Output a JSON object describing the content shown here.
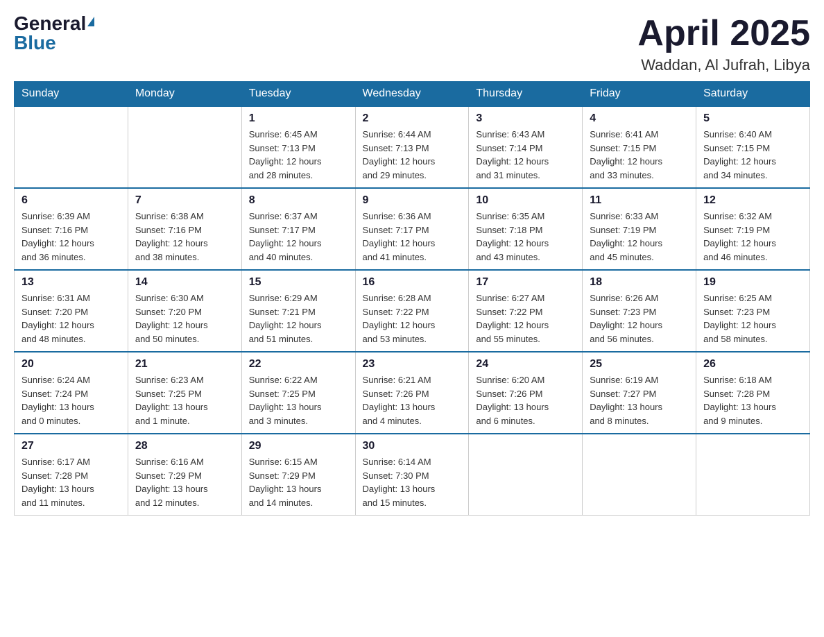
{
  "header": {
    "logo_general": "General",
    "logo_blue": "Blue",
    "title": "April 2025",
    "location": "Waddan, Al Jufrah, Libya"
  },
  "days_of_week": [
    "Sunday",
    "Monday",
    "Tuesday",
    "Wednesday",
    "Thursday",
    "Friday",
    "Saturday"
  ],
  "weeks": [
    [
      {
        "day": "",
        "info": ""
      },
      {
        "day": "",
        "info": ""
      },
      {
        "day": "1",
        "info": "Sunrise: 6:45 AM\nSunset: 7:13 PM\nDaylight: 12 hours\nand 28 minutes."
      },
      {
        "day": "2",
        "info": "Sunrise: 6:44 AM\nSunset: 7:13 PM\nDaylight: 12 hours\nand 29 minutes."
      },
      {
        "day": "3",
        "info": "Sunrise: 6:43 AM\nSunset: 7:14 PM\nDaylight: 12 hours\nand 31 minutes."
      },
      {
        "day": "4",
        "info": "Sunrise: 6:41 AM\nSunset: 7:15 PM\nDaylight: 12 hours\nand 33 minutes."
      },
      {
        "day": "5",
        "info": "Sunrise: 6:40 AM\nSunset: 7:15 PM\nDaylight: 12 hours\nand 34 minutes."
      }
    ],
    [
      {
        "day": "6",
        "info": "Sunrise: 6:39 AM\nSunset: 7:16 PM\nDaylight: 12 hours\nand 36 minutes."
      },
      {
        "day": "7",
        "info": "Sunrise: 6:38 AM\nSunset: 7:16 PM\nDaylight: 12 hours\nand 38 minutes."
      },
      {
        "day": "8",
        "info": "Sunrise: 6:37 AM\nSunset: 7:17 PM\nDaylight: 12 hours\nand 40 minutes."
      },
      {
        "day": "9",
        "info": "Sunrise: 6:36 AM\nSunset: 7:17 PM\nDaylight: 12 hours\nand 41 minutes."
      },
      {
        "day": "10",
        "info": "Sunrise: 6:35 AM\nSunset: 7:18 PM\nDaylight: 12 hours\nand 43 minutes."
      },
      {
        "day": "11",
        "info": "Sunrise: 6:33 AM\nSunset: 7:19 PM\nDaylight: 12 hours\nand 45 minutes."
      },
      {
        "day": "12",
        "info": "Sunrise: 6:32 AM\nSunset: 7:19 PM\nDaylight: 12 hours\nand 46 minutes."
      }
    ],
    [
      {
        "day": "13",
        "info": "Sunrise: 6:31 AM\nSunset: 7:20 PM\nDaylight: 12 hours\nand 48 minutes."
      },
      {
        "day": "14",
        "info": "Sunrise: 6:30 AM\nSunset: 7:20 PM\nDaylight: 12 hours\nand 50 minutes."
      },
      {
        "day": "15",
        "info": "Sunrise: 6:29 AM\nSunset: 7:21 PM\nDaylight: 12 hours\nand 51 minutes."
      },
      {
        "day": "16",
        "info": "Sunrise: 6:28 AM\nSunset: 7:22 PM\nDaylight: 12 hours\nand 53 minutes."
      },
      {
        "day": "17",
        "info": "Sunrise: 6:27 AM\nSunset: 7:22 PM\nDaylight: 12 hours\nand 55 minutes."
      },
      {
        "day": "18",
        "info": "Sunrise: 6:26 AM\nSunset: 7:23 PM\nDaylight: 12 hours\nand 56 minutes."
      },
      {
        "day": "19",
        "info": "Sunrise: 6:25 AM\nSunset: 7:23 PM\nDaylight: 12 hours\nand 58 minutes."
      }
    ],
    [
      {
        "day": "20",
        "info": "Sunrise: 6:24 AM\nSunset: 7:24 PM\nDaylight: 13 hours\nand 0 minutes."
      },
      {
        "day": "21",
        "info": "Sunrise: 6:23 AM\nSunset: 7:25 PM\nDaylight: 13 hours\nand 1 minute."
      },
      {
        "day": "22",
        "info": "Sunrise: 6:22 AM\nSunset: 7:25 PM\nDaylight: 13 hours\nand 3 minutes."
      },
      {
        "day": "23",
        "info": "Sunrise: 6:21 AM\nSunset: 7:26 PM\nDaylight: 13 hours\nand 4 minutes."
      },
      {
        "day": "24",
        "info": "Sunrise: 6:20 AM\nSunset: 7:26 PM\nDaylight: 13 hours\nand 6 minutes."
      },
      {
        "day": "25",
        "info": "Sunrise: 6:19 AM\nSunset: 7:27 PM\nDaylight: 13 hours\nand 8 minutes."
      },
      {
        "day": "26",
        "info": "Sunrise: 6:18 AM\nSunset: 7:28 PM\nDaylight: 13 hours\nand 9 minutes."
      }
    ],
    [
      {
        "day": "27",
        "info": "Sunrise: 6:17 AM\nSunset: 7:28 PM\nDaylight: 13 hours\nand 11 minutes."
      },
      {
        "day": "28",
        "info": "Sunrise: 6:16 AM\nSunset: 7:29 PM\nDaylight: 13 hours\nand 12 minutes."
      },
      {
        "day": "29",
        "info": "Sunrise: 6:15 AM\nSunset: 7:29 PM\nDaylight: 13 hours\nand 14 minutes."
      },
      {
        "day": "30",
        "info": "Sunrise: 6:14 AM\nSunset: 7:30 PM\nDaylight: 13 hours\nand 15 minutes."
      },
      {
        "day": "",
        "info": ""
      },
      {
        "day": "",
        "info": ""
      },
      {
        "day": "",
        "info": ""
      }
    ]
  ]
}
